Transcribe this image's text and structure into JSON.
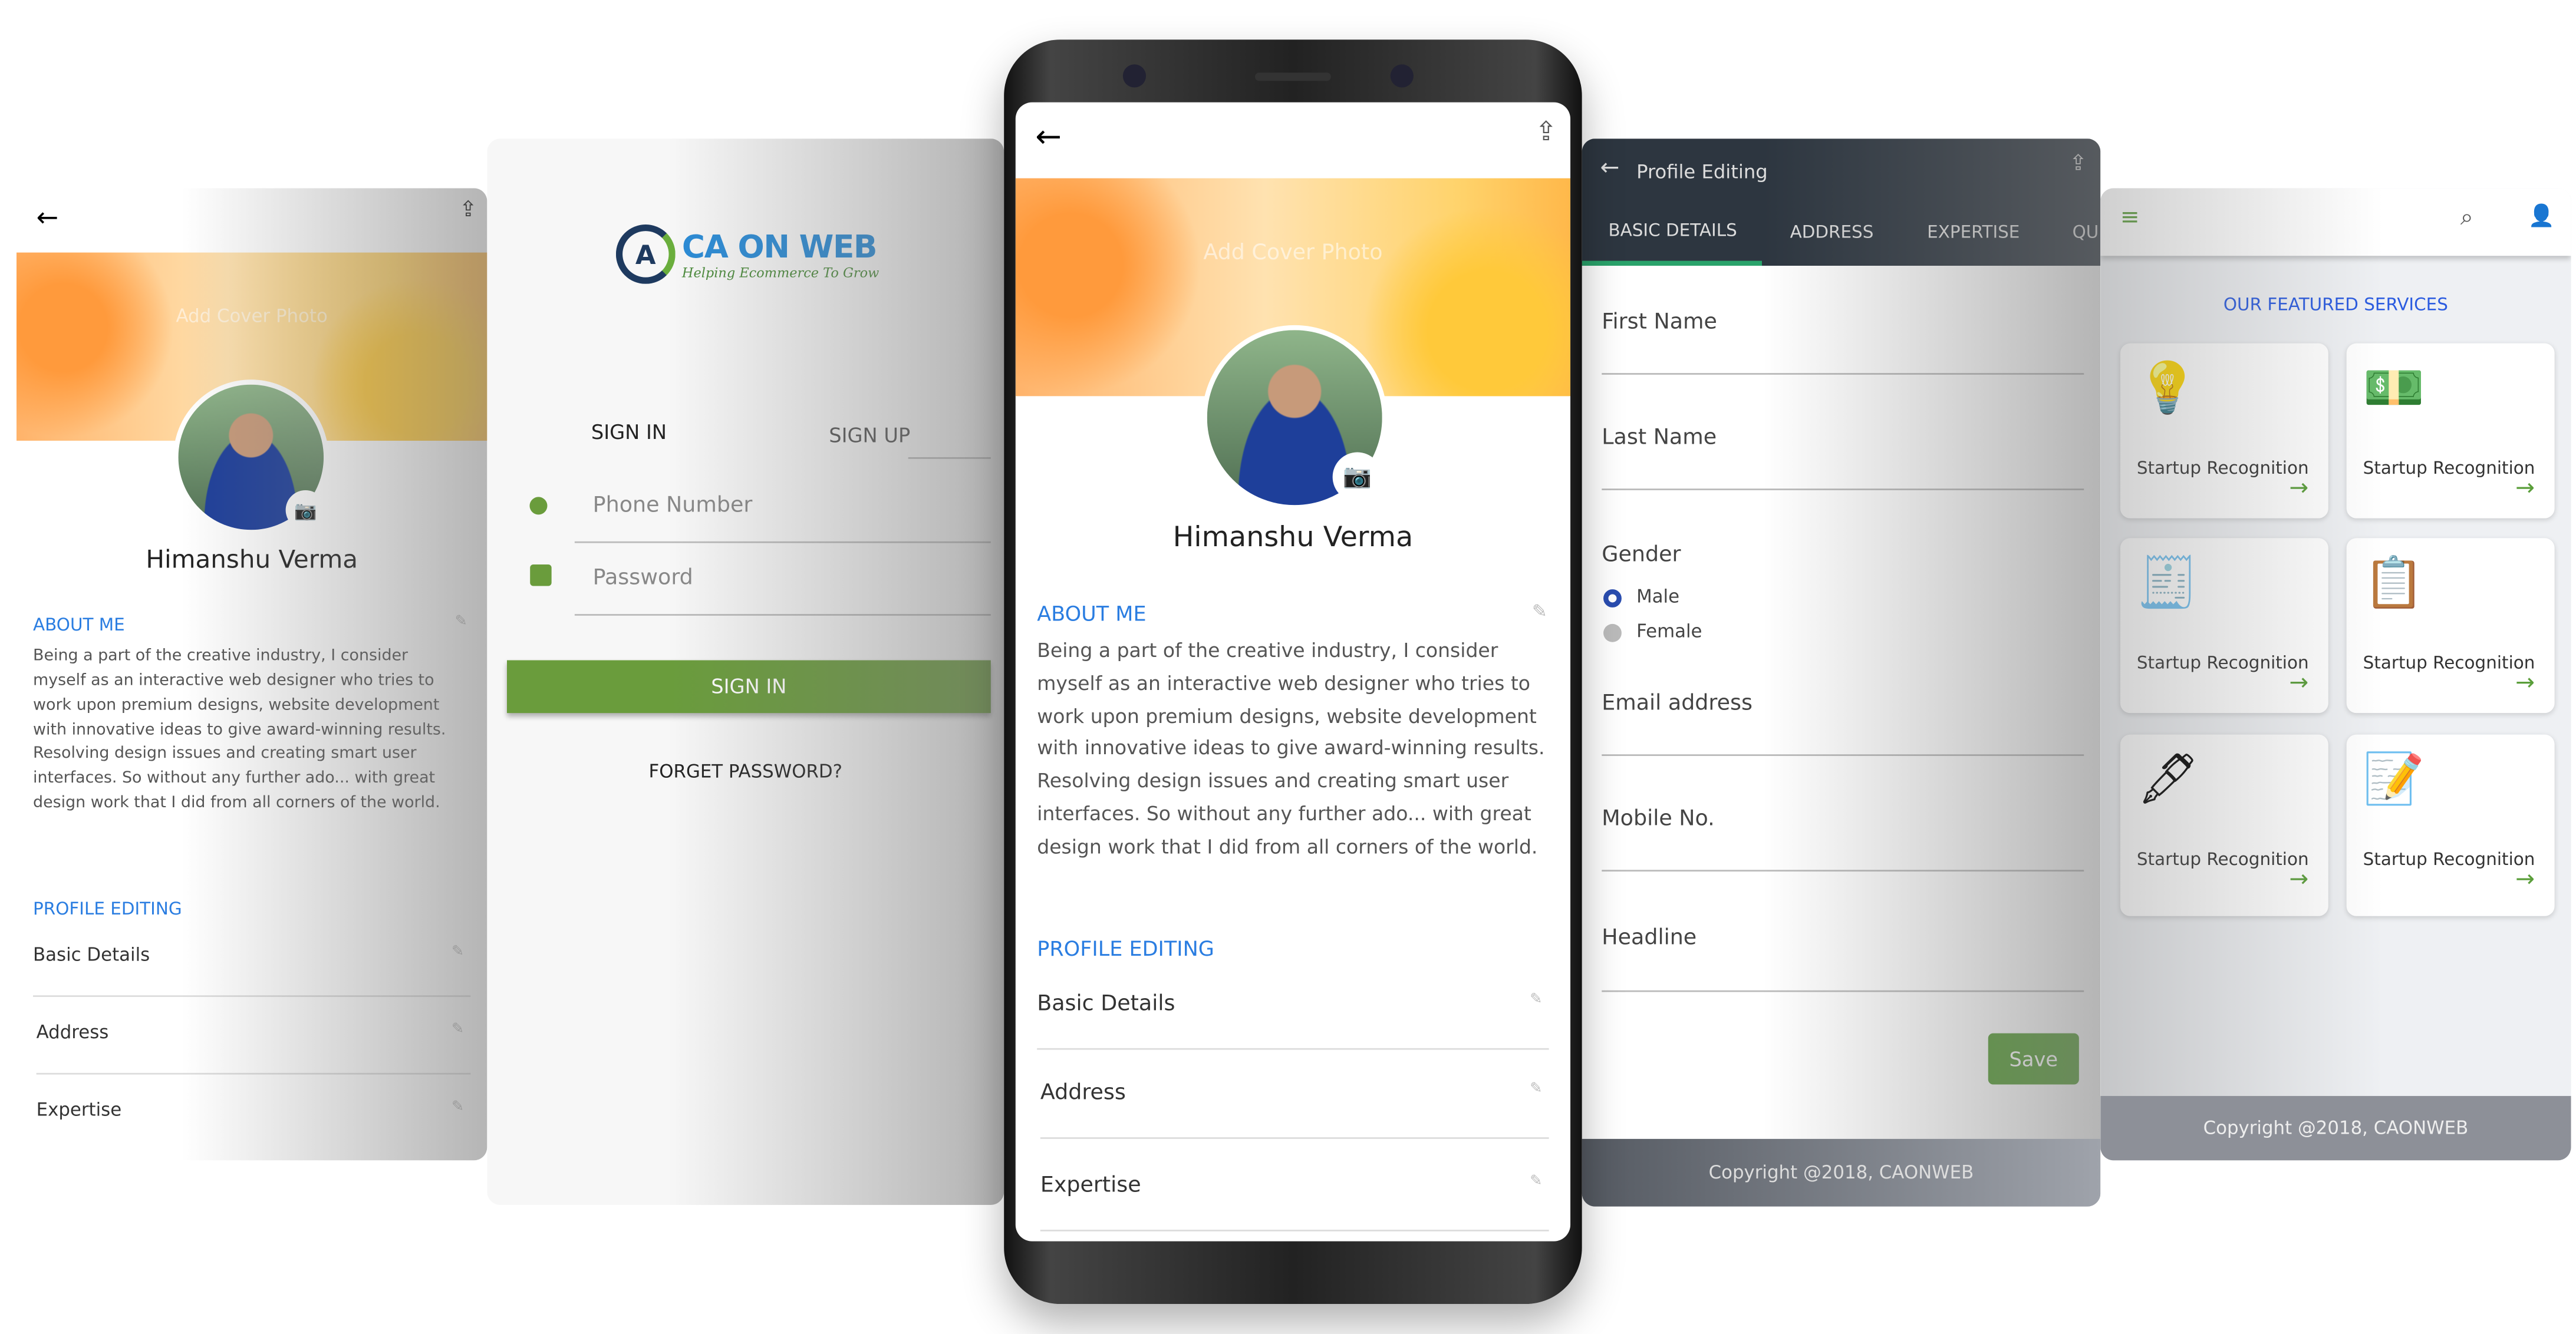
{
  "profile_screen": {
    "back_icon": "arrow-left-icon",
    "share_icon": "share-icon",
    "cover_label": "Add Cover Photo",
    "name": "Himanshu Verma",
    "about_heading": "ABOUT ME",
    "about_text": "Being a part of the creative industry, I consider myself as an interactive web designer who tries to work upon premium designs, website development with innovative ideas to give award-winning results. Resolving design issues and creating smart user interfaces. So without any further ado... with great design work that I did from all corners of the world.",
    "editing_heading": "PROFILE EDITING",
    "items": [
      "Basic Details",
      "Address",
      "Expertise"
    ]
  },
  "login_screen": {
    "logo": {
      "brand": "CA ON WEB",
      "tagline": "Helping Ecommerce To Grow"
    },
    "tabs": [
      "SIGN IN",
      "SIGN UP"
    ],
    "phone_placeholder": "Phone Number",
    "password_placeholder": "Password",
    "signin_button": "SIGN IN",
    "forgot": "FORGET PASSWORD?",
    "accent": "#6a9c3c"
  },
  "edit_screen": {
    "title": "Profile Editing",
    "tabs": [
      "BASIC DETAILS",
      "ADDRESS",
      "EXPERTISE",
      "QU"
    ],
    "fields": {
      "first_name": "First Name",
      "last_name": "Last Name",
      "gender": "Gender",
      "male": "Male",
      "female": "Female",
      "email": "Email address",
      "mobile": "Mobile No.",
      "headline": "Headline"
    },
    "gender_selected": "Male",
    "save": "Save",
    "footer": "Copyright @2018, CAONWEB",
    "header_color": "#2d3640"
  },
  "services_screen": {
    "heading": "OUR FEATURED SERVICES",
    "cards": [
      {
        "label": "Startup Recognition",
        "icon": "lightbulb-dollar-icon"
      },
      {
        "label": "Startup Recognition",
        "icon": "money-coins-icon"
      },
      {
        "label": "Startup Recognition",
        "icon": "gst-document-icon"
      },
      {
        "label": "Startup Recognition",
        "icon": "stamp-document-icon"
      },
      {
        "label": "Startup Recognition",
        "icon": "pen-document-icon"
      },
      {
        "label": "Startup Recognition",
        "icon": "edit-document-icon"
      }
    ],
    "footer": "Copyright @2018, CAONWEB"
  }
}
